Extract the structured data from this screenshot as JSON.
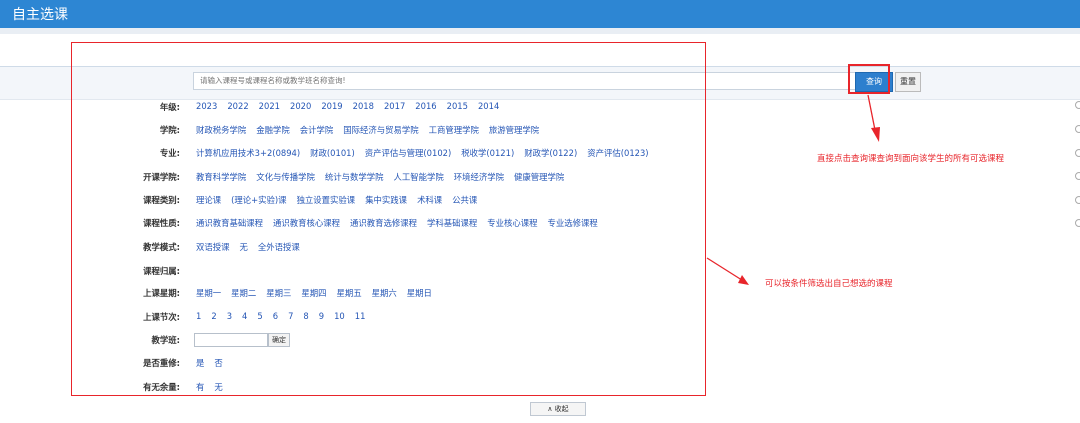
{
  "header": {
    "title": "自主选课"
  },
  "search": {
    "placeholder": "请输入课程号或课程名称或教学班名称查询!",
    "query_label": "查询",
    "reset_label": "重置"
  },
  "filters": [
    {
      "label": "年级:",
      "options": [
        "2023",
        "2022",
        "2021",
        "2020",
        "2019",
        "2018",
        "2017",
        "2016",
        "2015",
        "2014"
      ]
    },
    {
      "label": "学院:",
      "options": [
        "财政税务学院",
        "金融学院",
        "会计学院",
        "国际经济与贸易学院",
        "工商管理学院",
        "旅游管理学院"
      ]
    },
    {
      "label": "专业:",
      "options": [
        "计算机应用技术3+2(0894)",
        "财政(0101)",
        "资产评估与管理(0102)",
        "税收学(0121)",
        "财政学(0122)",
        "资产评估(0123)"
      ]
    },
    {
      "label": "开课学院:",
      "options": [
        "教育科学学院",
        "文化与传播学院",
        "统计与数学学院",
        "人工智能学院",
        "环境经济学院",
        "健康管理学院"
      ]
    },
    {
      "label": "课程类别:",
      "options": [
        "理论课",
        "(理论+实验)课",
        "独立设置实验课",
        "集中实践课",
        "术科课",
        "公共课"
      ]
    },
    {
      "label": "课程性质:",
      "options": [
        "通识教育基础课程",
        "通识教育核心课程",
        "通识教育选修课程",
        "学科基础课程",
        "专业核心课程",
        "专业选修课程"
      ]
    },
    {
      "label": "教学模式:",
      "options": [
        "双语授课",
        "无",
        "全外语授课"
      ]
    },
    {
      "label": "课程归属:",
      "options": []
    },
    {
      "label": "上课星期:",
      "options": [
        "星期一",
        "星期二",
        "星期三",
        "星期四",
        "星期五",
        "星期六",
        "星期日"
      ]
    },
    {
      "label": "上课节次:",
      "options": [
        "1",
        "2",
        "3",
        "4",
        "5",
        "6",
        "7",
        "8",
        "9",
        "10",
        "11"
      ]
    },
    {
      "label": "教学班:",
      "options": []
    },
    {
      "label": "是否重修:",
      "options": [
        "是",
        "否"
      ]
    },
    {
      "label": "有无余量:",
      "options": [
        "有",
        "无"
      ]
    }
  ],
  "teacher_confirm_label": "确定",
  "annotations": {
    "query_note": "直接点击查询课查询到面向该学生的所有可选课程",
    "filter_note": "可以按条件筛选出自己想选的课程"
  },
  "bottom_button_label": "∧ 收起",
  "colors": {
    "header_bg": "#2d86d3",
    "link": "#2556b5",
    "annotation": "#e8252b"
  }
}
